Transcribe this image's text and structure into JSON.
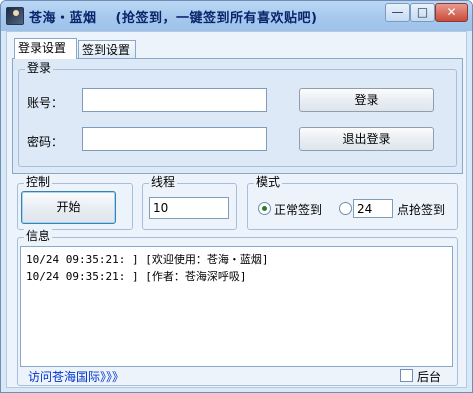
{
  "window": {
    "title": "苍海・蓝烟",
    "subtitle": "(抢签到，一键签到所有喜欢贴吧)",
    "minimize": "—",
    "maximize": "□",
    "close": "✕"
  },
  "tabs": [
    {
      "label": "登录设置",
      "active": true
    },
    {
      "label": "签到设置",
      "active": false
    }
  ],
  "login": {
    "legend": "登录",
    "account_label": "账号：",
    "account_value": "",
    "password_label": "密码：",
    "password_value": "",
    "login_button": "登录",
    "logout_button": "退出登录"
  },
  "control": {
    "legend": "控制",
    "start_button": "开始"
  },
  "threads": {
    "legend": "线程",
    "value": "10"
  },
  "mode": {
    "legend": "模式",
    "normal_label": "正常签到",
    "normal_checked": true,
    "timed_value": "24",
    "timed_label": "点抢签到",
    "timed_checked": false
  },
  "info": {
    "legend": "信息",
    "log": [
      "10/24 09:35:21: ]  [欢迎使用：苍海・蓝烟]",
      "10/24 09:35:21: ]  [作者：苍海深呼吸]"
    ]
  },
  "footer": {
    "visit_link": "访问苍海国际》》》",
    "background_label": "后台",
    "background_checked": false
  },
  "colors": {
    "accent": "#0a246a",
    "link": "#0033cc",
    "panel": "#dde9f6"
  }
}
